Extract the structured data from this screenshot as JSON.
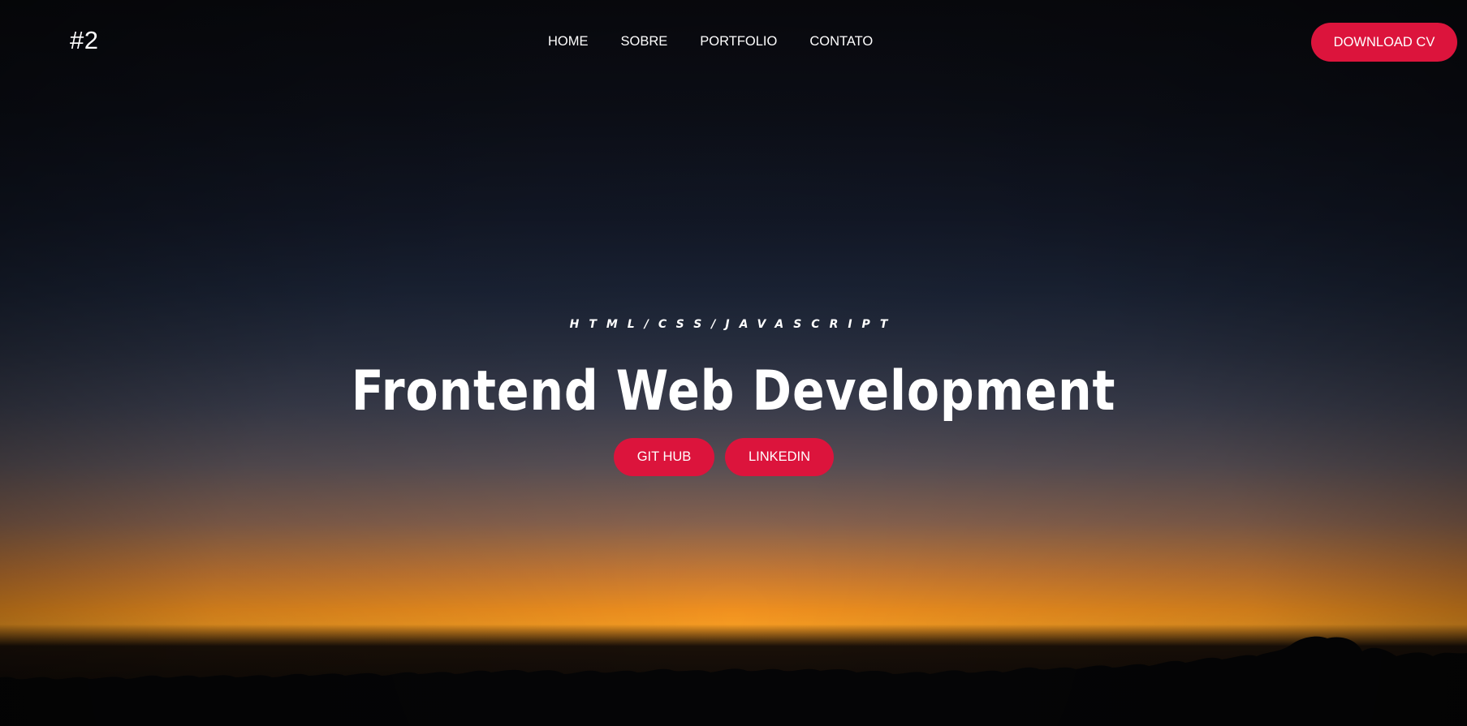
{
  "logo": "#2",
  "nav": {
    "items": [
      "HOME",
      "SOBRE",
      "PORTFOLIO",
      "CONTATO"
    ],
    "download_label": "DOWNLOAD CV"
  },
  "hero": {
    "subtitle": "HTML/CSS/JAVASCRIPT",
    "title": "Frontend Web Development",
    "github_label": "GIT HUB",
    "linkedin_label": "LINKEDIN"
  },
  "colors": {
    "accent": "#dc143c",
    "text": "#ffffff",
    "sky_top": "#0b0c12",
    "horizon": "#f59a22"
  }
}
